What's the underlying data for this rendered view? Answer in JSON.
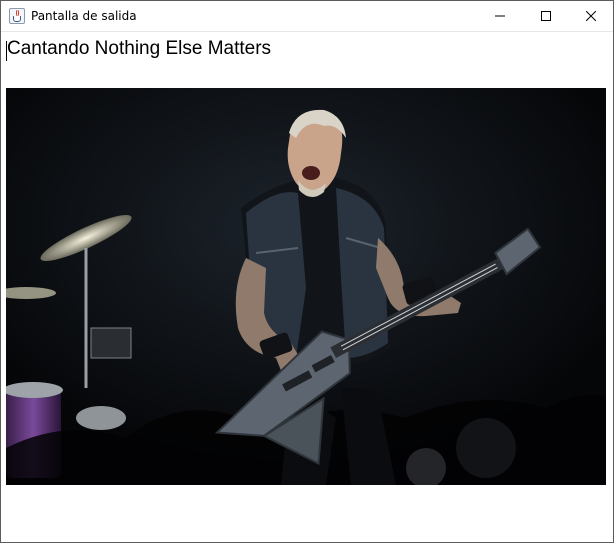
{
  "window": {
    "title": "Pantalla de salida",
    "app_icon": "java-cup-icon",
    "controls": {
      "minimize": "minimize-icon",
      "maximize": "maximize-icon",
      "close": "close-icon"
    }
  },
  "content": {
    "headline": "Cantando Nothing Else Matters"
  },
  "colors": {
    "photo_background": "#07080b",
    "guitar": "#5d6670"
  }
}
